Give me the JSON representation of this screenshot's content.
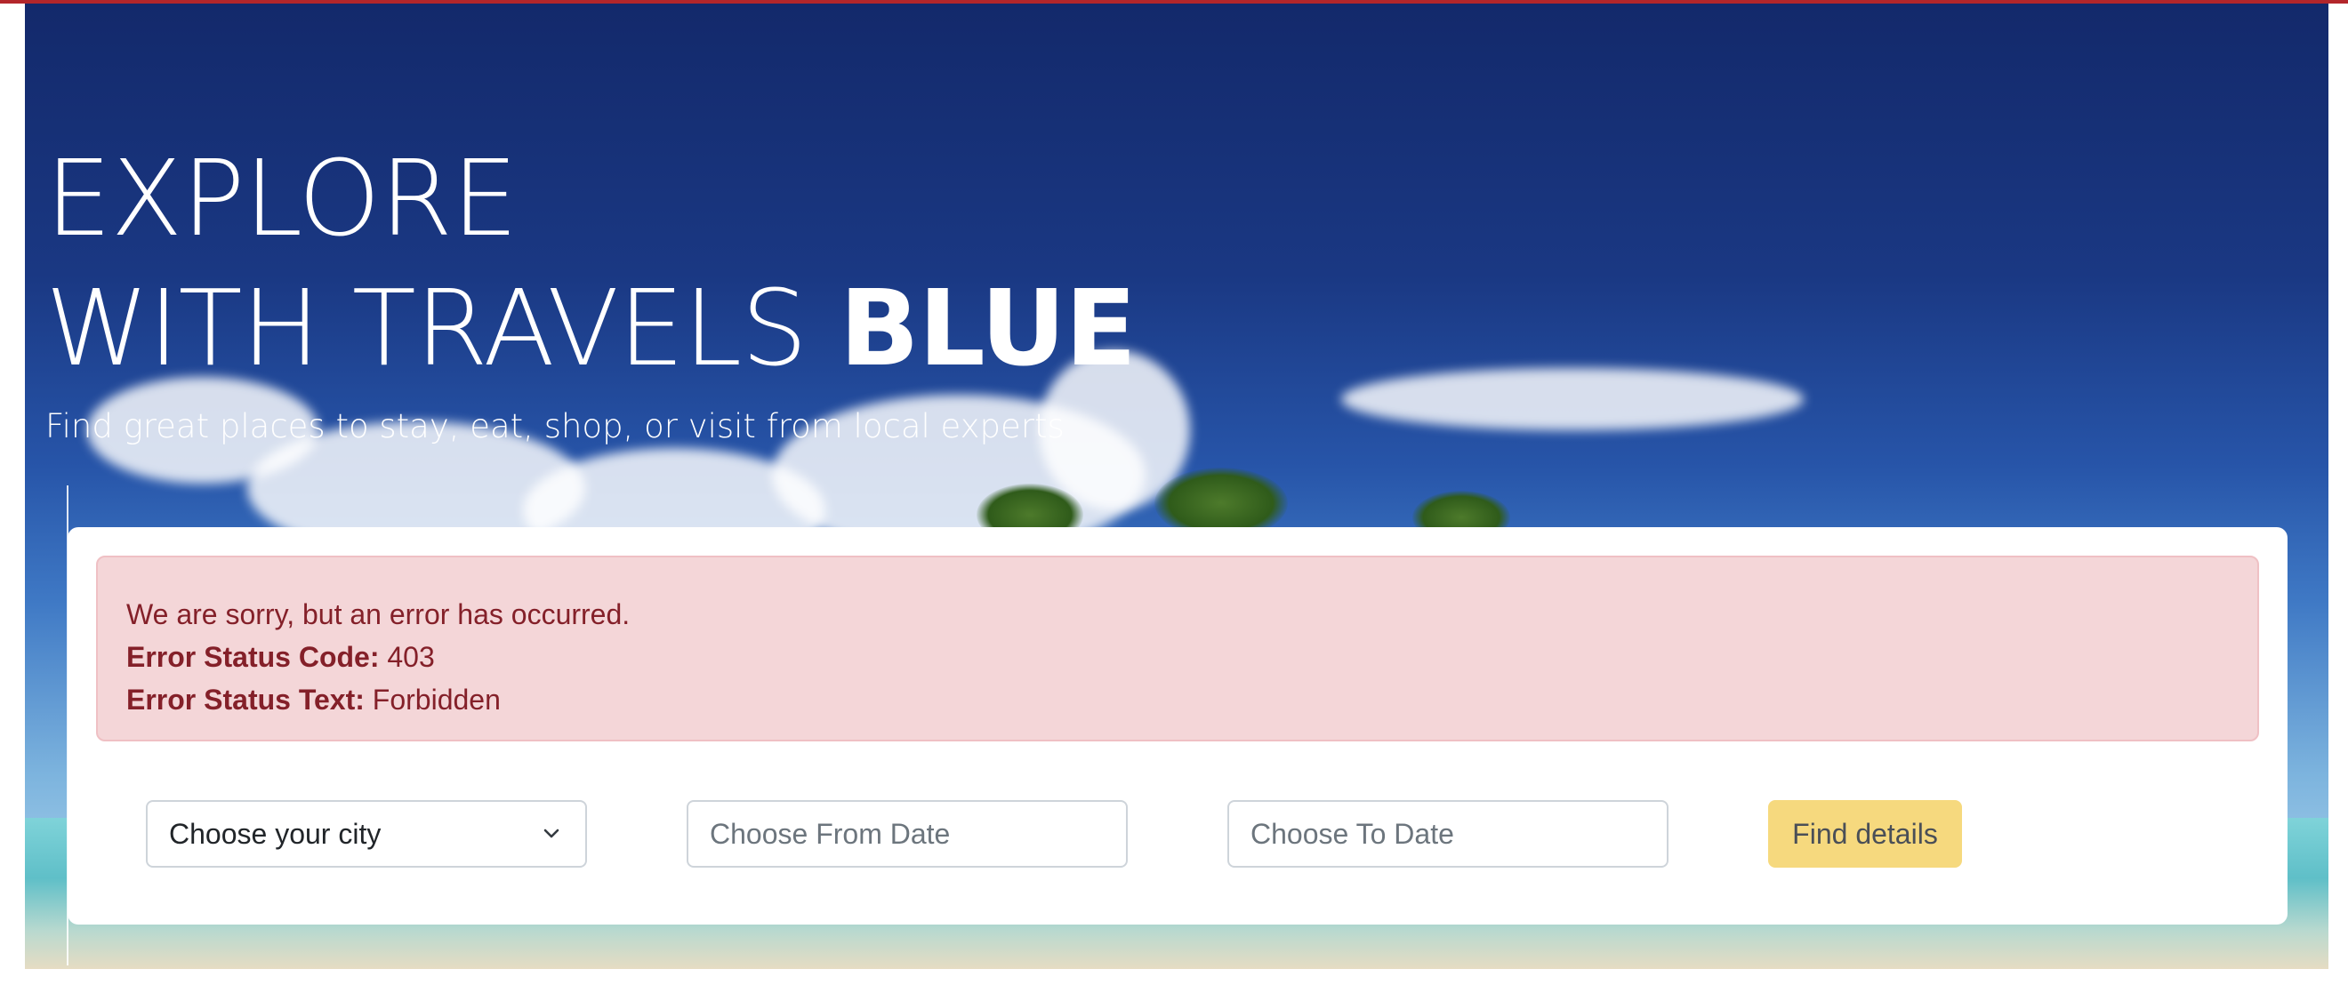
{
  "hero": {
    "title_line1": "EXPLORE",
    "title_line2_prefix": "WITH TRAVELS ",
    "title_brand": "BLUE",
    "subtitle": "Find great places to stay, eat, shop, or visit from local experts"
  },
  "error_alert": {
    "message": "We are sorry, but an error has occurred.",
    "status_code_label": "Error Status Code:",
    "status_code_value": "403",
    "status_text_label": "Error Status Text:",
    "status_text_value": "Forbidden"
  },
  "search": {
    "city_select_value": "Choose your city",
    "from_date_placeholder": "Choose From Date",
    "to_date_placeholder": "Choose To Date",
    "submit_label": "Find details"
  },
  "icons": {
    "city_select": "chevron-down-icon"
  },
  "colors": {
    "top_rule": "#b3262b",
    "alert_background": "#f4d6d8",
    "alert_text": "#842029",
    "button_background": "#f6d97e"
  }
}
